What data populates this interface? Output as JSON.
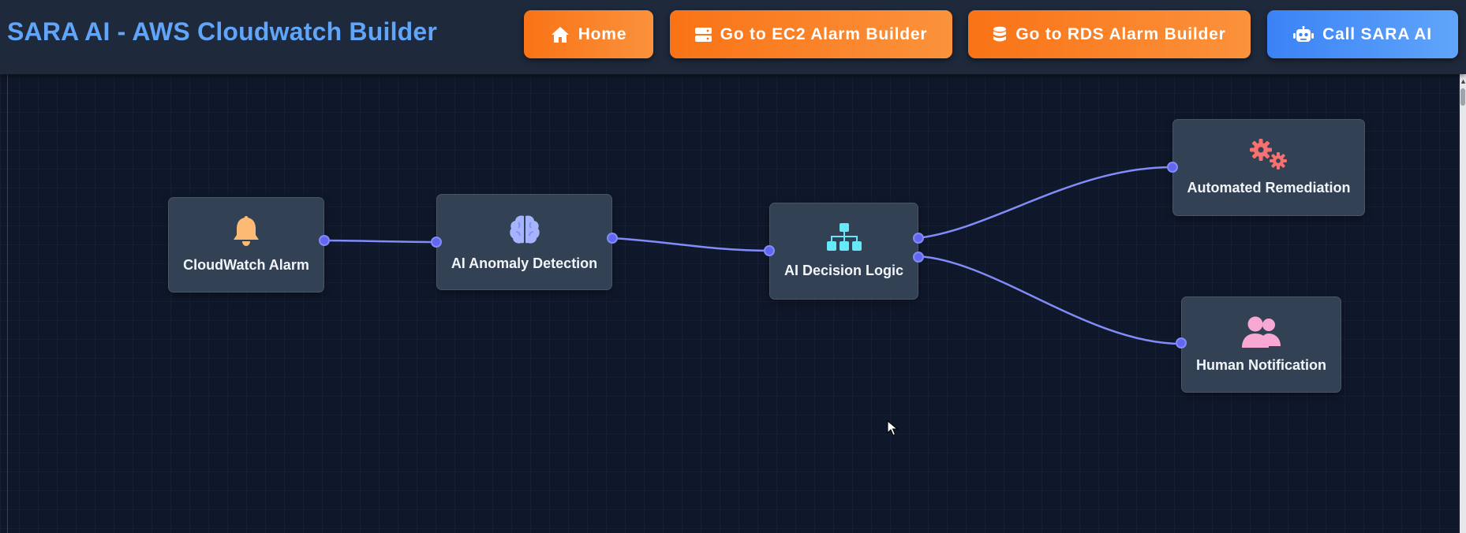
{
  "app": {
    "title": "SARA AI - AWS Cloudwatch Builder"
  },
  "nav": {
    "home": {
      "label": "Home",
      "icon": "home-icon"
    },
    "ec2": {
      "label": "Go to EC2 Alarm Builder",
      "icon": "server-icon"
    },
    "rds": {
      "label": "Go to RDS Alarm Builder",
      "icon": "database-icon"
    },
    "sara": {
      "label": "Call SARA AI",
      "icon": "robot-icon"
    }
  },
  "colors": {
    "header_bg": "#1e293b",
    "canvas_bg": "#0f172a",
    "title": "#60a5fa",
    "orange_button": "#f97316",
    "blue_button": "#3b82f6",
    "node_bg": "#334155",
    "edge": "#818cf8",
    "port": "#6366f1"
  },
  "nodes": [
    {
      "id": "cloudwatch",
      "label": "CloudWatch Alarm",
      "icon": "bell-icon",
      "icon_color": "#fdba74"
    },
    {
      "id": "anomaly",
      "label": "AI Anomaly Detection",
      "icon": "brain-icon",
      "icon_color": "#a5b4fc"
    },
    {
      "id": "decision",
      "label": "AI Decision Logic",
      "icon": "sitemap-icon",
      "icon_color": "#67e8f9"
    },
    {
      "id": "remediation",
      "label": "Automated Remediation",
      "icon": "gears-icon",
      "icon_color": "#f87171"
    },
    {
      "id": "notification",
      "label": "Human Notification",
      "icon": "users-icon",
      "icon_color": "#f9a8d4"
    }
  ],
  "edges": [
    {
      "from": "cloudwatch",
      "to": "anomaly"
    },
    {
      "from": "anomaly",
      "to": "decision"
    },
    {
      "from": "decision",
      "to": "remediation"
    },
    {
      "from": "decision",
      "to": "notification"
    }
  ]
}
